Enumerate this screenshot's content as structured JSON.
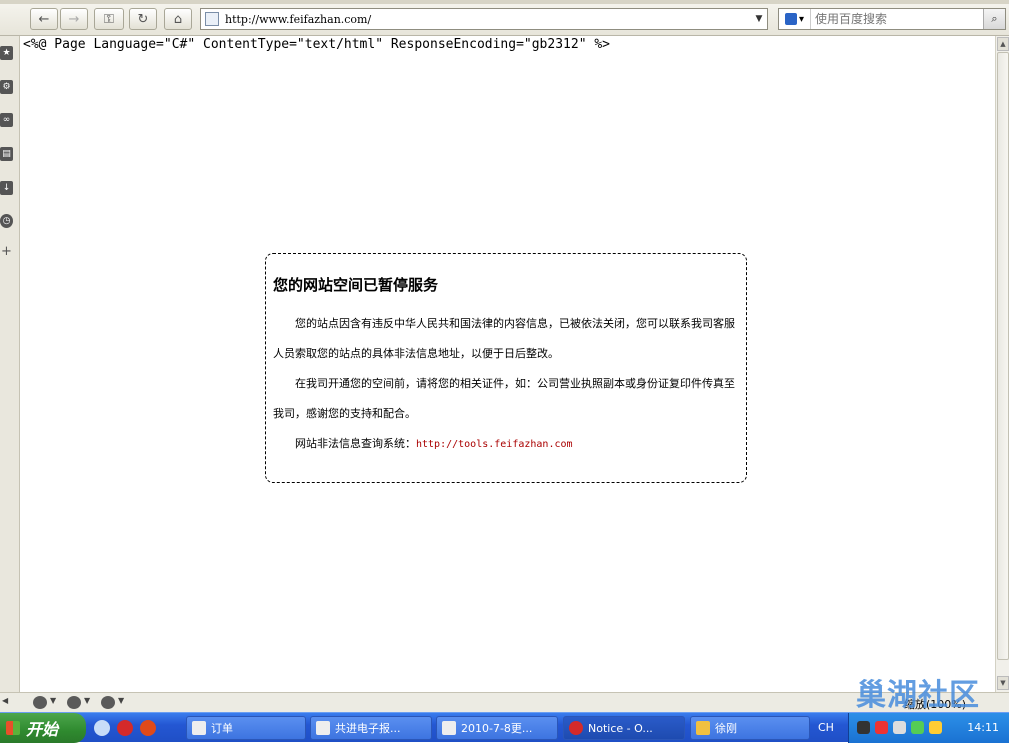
{
  "browser": {
    "address_url": "http://www.feifazhan.com/",
    "search_placeholder": "使用百度搜索"
  },
  "page": {
    "directive": "<%@ Page Language=\"C#\" ContentType=\"text/html\" ResponseEncoding=\"gb2312\" %>",
    "title": "您的网站空间已暂停服务",
    "paragraph1": "您的站点因含有违反中华人民共和国法律的内容信息，已被依法关闭，您可以联系我司客服人员索取您的站点的具体非法信息地址，以便于日后整改。",
    "paragraph2": "在我司开通您的空间前，请将您的相关证件，如：公司营业执照副本或身份证复印件传真至我司，感谢您的支持和配合。",
    "query_label": "网站非法信息查询系统：",
    "query_link": "http://tools.feifazhan.com"
  },
  "statusbar": {
    "zoom": "缩放(100%)"
  },
  "taskbar": {
    "start_label": "开始",
    "tasks": [
      "订单",
      "共进电子报...",
      "2010-7-8更...",
      "Notice - O...",
      "徐刚"
    ],
    "language": "CH",
    "clock": "14:11"
  },
  "watermark": "巢湖社区"
}
